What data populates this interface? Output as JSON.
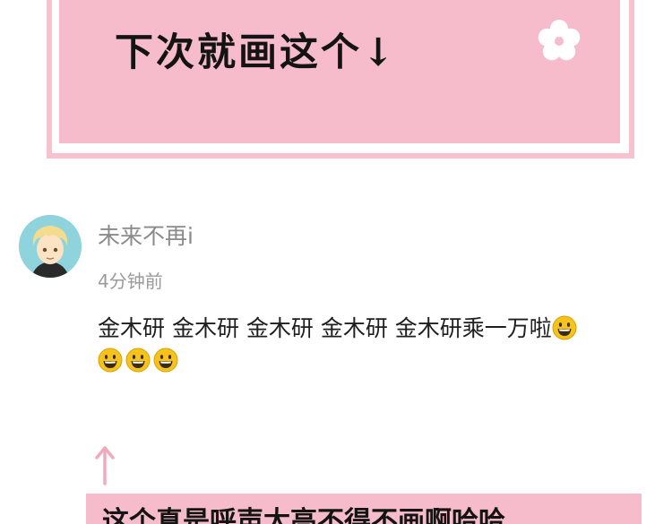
{
  "banner": {
    "title": "下次就画这个↓"
  },
  "comment": {
    "username": "未来不再i",
    "time": "4分钟前",
    "text": "金木研 金木研 金木研 金木研 金木研乘一万啦"
  },
  "caption": {
    "text": "这个真是呼声太高不得不画啊哈哈"
  },
  "colors": {
    "pink": "#f6bccb",
    "text": "#1e1e1e",
    "muted": "#8a8a8a",
    "emoji": "#f6c21c"
  },
  "icons": [
    "flower-icon",
    "avatar-image",
    "grinning-emoji-icon",
    "up-arrow-icon"
  ]
}
